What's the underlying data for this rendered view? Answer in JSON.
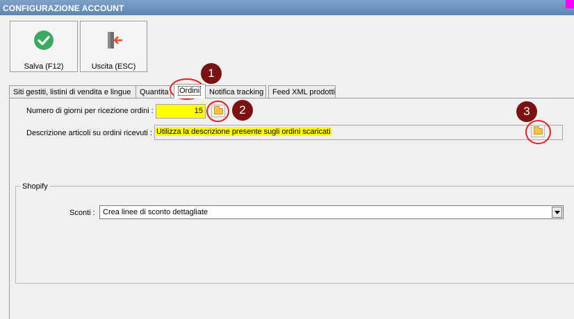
{
  "window": {
    "title": "CONFIGURAZIONE ACCOUNT"
  },
  "toolbar": {
    "save_label": "Salva (F12)",
    "exit_label": "Uscita (ESC)"
  },
  "tabs": [
    {
      "label": "Siti gestiti, listini di vendita e lingue"
    },
    {
      "label": "Quantita"
    },
    {
      "label": "Ordini"
    },
    {
      "label": "Notifica tracking"
    },
    {
      "label": "Feed XML prodotti"
    }
  ],
  "ordini": {
    "days_label": "Numero di giorni per ricezione ordini :",
    "days_value": "15",
    "description_label": "Descrizione articoli su ordini ricevuti :",
    "description_value": "Utilizza la descrizione presente sugli ordini scaricati"
  },
  "shopify": {
    "title": "Shopify",
    "discounts_label": "Sconti :",
    "discounts_value": "Crea linee di sconto dettagliate"
  },
  "annotations": {
    "one": "1",
    "two": "2",
    "three": "3"
  },
  "colors": {
    "highlight": "#ffff00",
    "annotation_ring": "#e32020",
    "badge": "#7a1212",
    "save_icon": "#3aaa62"
  }
}
